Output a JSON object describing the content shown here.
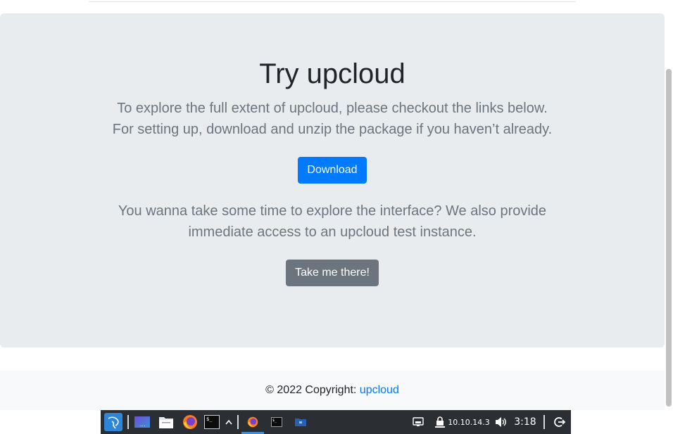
{
  "hero": {
    "title": "Try upcloud",
    "lead_line_1": "To explore the full extent of upcloud, please checkout the links below.",
    "lead_line_2": "For setting up, download and unzip the package if you haven’t already.",
    "download_label": "Download",
    "explore_line_1": "You wanna take some time to explore the interface? We also provide",
    "explore_line_2": "immediate access to an upcloud test instance.",
    "take_me_label": "Take me there!"
  },
  "footer": {
    "copyright_prefix": "© 2022 Copyright: ",
    "link_text": "upcloud"
  },
  "taskbar": {
    "icons": [
      "kali-menu-icon",
      "workspace-icon",
      "file-manager-icon",
      "firefox-icon",
      "terminal-icon",
      "overflow-chevron-icon"
    ],
    "tasks": [
      "firefox-task-icon",
      "terminal-task-icon",
      "folder-task-icon"
    ],
    "ip_address": "10.10.14.3",
    "clock": "3:18"
  },
  "colors": {
    "primary": "#007bff",
    "secondary": "#6c757d",
    "jumbotron_bg": "#e9ecef",
    "taskbar_bg": "#2b2f33"
  }
}
